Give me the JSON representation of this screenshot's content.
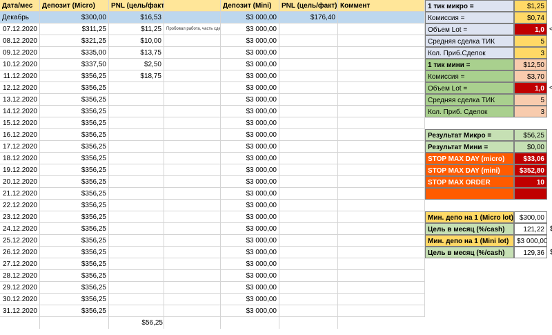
{
  "colors": {
    "header_bg": "#ffe699",
    "month_bg": "#bdd7ee",
    "label_blue_bg": "#dde3f1",
    "label_green_bg": "#a9d08e",
    "result_bg": "#c6e0b4",
    "stop_label_bg": "#ff5b00",
    "stop_value_bg": "#c00000",
    "value_yellow_bg": "#ffd966",
    "value_orange_bg": "#f8cbad",
    "value_red_bg": "#c00000",
    "value_light_yellow_bg": "#fff2cc"
  },
  "headers": {
    "date": "Дата/мес",
    "deposit_micro": "Депозит (Micro)",
    "pnl_micro": "PNL (цель/факт)",
    "deposit_mini": "Депозит (Mini)",
    "pnl_mini": "PNL (цель/факт)",
    "comment": "Коммент"
  },
  "month_row": {
    "label": "Декабрь",
    "deposit_micro": "$300,00",
    "pnl_micro": "$16,53",
    "deposit_mini": "$3 000,00",
    "pnl_mini": "$176,40"
  },
  "rows": [
    {
      "date": "07.12.2020",
      "deposit_micro": "$311,25",
      "pnl_micro": "$11,25",
      "note": "Пробовал работа, часть сделок",
      "deposit_mini": "$3 000,00"
    },
    {
      "date": "08.12.2020",
      "deposit_micro": "$321,25",
      "pnl_micro": "$10,00",
      "note": "",
      "deposit_mini": "$3 000,00"
    },
    {
      "date": "09.12.2020",
      "deposit_micro": "$335,00",
      "pnl_micro": "$13,75",
      "note": "",
      "deposit_mini": "$3 000,00"
    },
    {
      "date": "10.12.2020",
      "deposit_micro": "$337,50",
      "pnl_micro": "$2,50",
      "note": "",
      "deposit_mini": "$3 000,00"
    },
    {
      "date": "11.12.2020",
      "deposit_micro": "$356,25",
      "pnl_micro": "$18,75",
      "note": "",
      "deposit_mini": "$3 000,00"
    },
    {
      "date": "12.12.2020",
      "deposit_micro": "$356,25",
      "pnl_micro": "",
      "note": "",
      "deposit_mini": "$3 000,00"
    },
    {
      "date": "13.12.2020",
      "deposit_micro": "$356,25",
      "pnl_micro": "",
      "note": "",
      "deposit_mini": "$3 000,00"
    },
    {
      "date": "14.12.2020",
      "deposit_micro": "$356,25",
      "pnl_micro": "",
      "note": "",
      "deposit_mini": "$3 000,00"
    },
    {
      "date": "15.12.2020",
      "deposit_micro": "$356,25",
      "pnl_micro": "",
      "note": "",
      "deposit_mini": "$3 000,00"
    },
    {
      "date": "16.12.2020",
      "deposit_micro": "$356,25",
      "pnl_micro": "",
      "note": "",
      "deposit_mini": "$3 000,00"
    },
    {
      "date": "17.12.2020",
      "deposit_micro": "$356,25",
      "pnl_micro": "",
      "note": "",
      "deposit_mini": "$3 000,00"
    },
    {
      "date": "18.12.2020",
      "deposit_micro": "$356,25",
      "pnl_micro": "",
      "note": "",
      "deposit_mini": "$3 000,00"
    },
    {
      "date": "19.12.2020",
      "deposit_micro": "$356,25",
      "pnl_micro": "",
      "note": "",
      "deposit_mini": "$3 000,00"
    },
    {
      "date": "20.12.2020",
      "deposit_micro": "$356,25",
      "pnl_micro": "",
      "note": "",
      "deposit_mini": "$3 000,00"
    },
    {
      "date": "21.12.2020",
      "deposit_micro": "$356,25",
      "pnl_micro": "",
      "note": "",
      "deposit_mini": "$3 000,00"
    },
    {
      "date": "22.12.2020",
      "deposit_micro": "$356,25",
      "pnl_micro": "",
      "note": "",
      "deposit_mini": "$3 000,00"
    },
    {
      "date": "23.12.2020",
      "deposit_micro": "$356,25",
      "pnl_micro": "",
      "note": "",
      "deposit_mini": "$3 000,00"
    },
    {
      "date": "24.12.2020",
      "deposit_micro": "$356,25",
      "pnl_micro": "",
      "note": "",
      "deposit_mini": "$3 000,00"
    },
    {
      "date": "25.12.2020",
      "deposit_micro": "$356,25",
      "pnl_micro": "",
      "note": "",
      "deposit_mini": "$3 000,00"
    },
    {
      "date": "26.12.2020",
      "deposit_micro": "$356,25",
      "pnl_micro": "",
      "note": "",
      "deposit_mini": "$3 000,00"
    },
    {
      "date": "27.12.2020",
      "deposit_micro": "$356,25",
      "pnl_micro": "",
      "note": "",
      "deposit_mini": "$3 000,00"
    },
    {
      "date": "28.12.2020",
      "deposit_micro": "$356,25",
      "pnl_micro": "",
      "note": "",
      "deposit_mini": "$3 000,00"
    },
    {
      "date": "29.12.2020",
      "deposit_micro": "$356,25",
      "pnl_micro": "",
      "note": "",
      "deposit_mini": "$3 000,00"
    },
    {
      "date": "30.12.2020",
      "deposit_micro": "$356,25",
      "pnl_micro": "",
      "note": "",
      "deposit_mini": "$3 000,00"
    },
    {
      "date": "31.12.2020",
      "deposit_micro": "$356,25",
      "pnl_micro": "",
      "note": "",
      "deposit_mini": "$3 000,00"
    }
  ],
  "total_pnl_micro": "$56,25",
  "side": {
    "micro_tick_label": "1 тик микро =",
    "micro_tick_value": "$1,25",
    "micro_commission_label": "Комиссия =",
    "micro_commission_value": "$0,74",
    "micro_lot_label": "Объем  Lot =",
    "micro_lot_value": "1,0",
    "micro_avg_label": "Средняя сделка ТИК",
    "micro_avg_value": "5",
    "micro_count_label": "Кол. Приб.Сделок",
    "micro_count_value": "3",
    "mini_tick_label": "1 тик мини =",
    "mini_tick_value": "$12,50",
    "mini_commission_label": "Комиссия =",
    "mini_commission_value": "$3,70",
    "mini_lot_label": "Объем  Lot =",
    "mini_lot_value": "1,0",
    "mini_avg_label": "Средняя сделка ТИК",
    "mini_avg_value": "5",
    "mini_count_label": "Кол. Приб. Сделок",
    "mini_count_value": "3",
    "result_micro_label": "Результат Микро =",
    "result_micro_value": "$56,25",
    "result_mini_label": "Результат Мини =",
    "result_mini_value": "$0,00",
    "stop_day_micro_label": "STOP MAX DAY (micro)",
    "stop_day_micro_value": "$33,06",
    "stop_day_mini_label": "STOP MAX DAY (mini)",
    "stop_day_mini_value": "$352,80",
    "stop_order_label": "STOP MAX ORDER",
    "stop_order_value": "10",
    "min_depo_micro_label": "Мин. депо на 1 (Micro lot)",
    "min_depo_micro_value": "$300,00",
    "goal_micro_label": "Цель в месяц (%/cash)",
    "goal_micro_value": "121,22",
    "min_depo_mini_label": "Мин. депо на 1 (Mini lot)",
    "min_depo_mini_value": "$3 000,00",
    "goal_mini_label": "Цель в месяц (%/cash)",
    "goal_mini_value": "129,36",
    "lot_arrow": "<",
    "cut_dollar": "$"
  }
}
